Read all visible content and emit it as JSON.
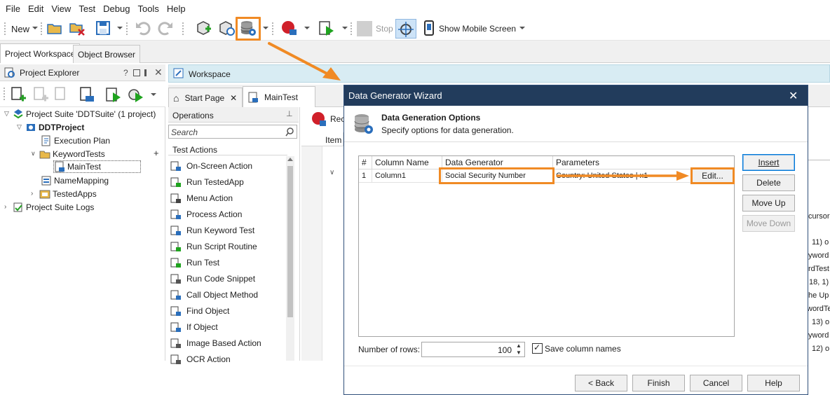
{
  "menu": [
    "File",
    "Edit",
    "View",
    "Test",
    "Debug",
    "Tools",
    "Help"
  ],
  "toolbar": {
    "new_label": "New",
    "stop_label": "Stop",
    "show_mobile_label": "Show Mobile Screen"
  },
  "tabs": {
    "project_workspace": "Project Workspace",
    "object_browser": "Object Browser"
  },
  "project_explorer": {
    "title": "Project Explorer",
    "help": "?",
    "tree": [
      "Project Suite 'DDTSuite' (1 project)",
      "DDTProject",
      "Execution Plan",
      "KeywordTests",
      "MainTest",
      "NameMapping",
      "TestedApps",
      "Project Suite Logs"
    ]
  },
  "workspace": {
    "title": "Workspace",
    "tab_start": "Start Page",
    "tab_main": "MainTest",
    "record_partial": "Rec",
    "column_item": "Item",
    "right_fragments": [
      "cursor",
      "11) o",
      "yword",
      "rdTest",
      "18, 1)",
      "the Up",
      "wordTe",
      "13) o",
      "yword",
      "12) o"
    ]
  },
  "operations": {
    "title": "Operations",
    "search_placeholder": "Search",
    "group": "Test Actions",
    "items": [
      "On-Screen Action",
      "Run TestedApp",
      "Menu Action",
      "Process Action",
      "Run Keyword Test",
      "Run Script Routine",
      "Run Test",
      "Run Code Snippet",
      "Call Object Method",
      "Find Object",
      "If Object",
      "Image Based Action",
      "OCR Action"
    ]
  },
  "dialog": {
    "title": "Data Generator Wizard",
    "heading": "Data Generation Options",
    "subheading": "Specify options for data generation.",
    "columns": [
      "#",
      "Column Name",
      "Data Generator",
      "Parameters"
    ],
    "rows": [
      {
        "num": "1",
        "name": "Column1",
        "generator": "Social Security Number",
        "params": "Country: United States | x1"
      }
    ],
    "edit_button": "Edit...",
    "buttons": {
      "insert": "Insert",
      "delete": "Delete",
      "move_up": "Move Up",
      "move_down": "Move Down"
    },
    "rows_label": "Number of rows:",
    "rows_value": "100",
    "save_names_label": "Save column names",
    "footer": {
      "back": "< Back",
      "finish": "Finish",
      "cancel": "Cancel",
      "help": "Help"
    }
  },
  "colors": {
    "accent": "#f08a24",
    "dialog_title_bg": "#223c5c",
    "workspace_bar": "#d8ecf3"
  }
}
